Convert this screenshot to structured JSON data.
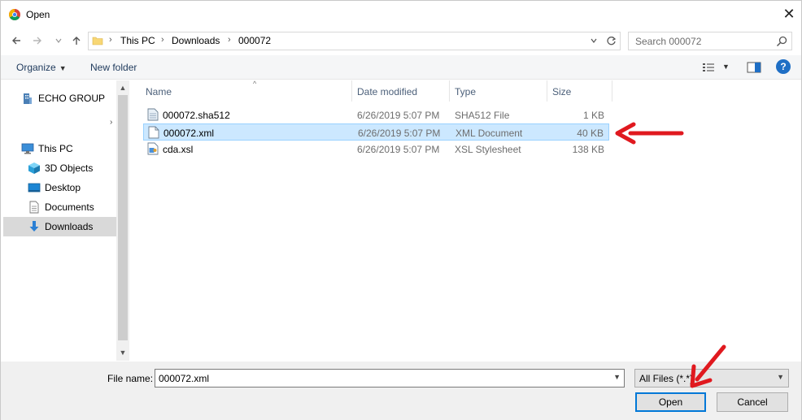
{
  "window": {
    "title": "Open",
    "close_glyph": "✕"
  },
  "address": {
    "crumbs": [
      "This PC",
      "Downloads",
      "000072"
    ],
    "separator": "›"
  },
  "search": {
    "placeholder": "Search 000072"
  },
  "toolbar": {
    "organize_label": "Organize",
    "new_folder_label": "New folder",
    "help_label": "?"
  },
  "nav": {
    "items": [
      {
        "label": "ECHO GROUP",
        "icon": "building-icon"
      },
      {
        "label": "This PC",
        "icon": "computer-icon"
      },
      {
        "label": "3D Objects",
        "icon": "3d-objects-icon"
      },
      {
        "label": "Desktop",
        "icon": "desktop-icon"
      },
      {
        "label": "Documents",
        "icon": "documents-icon"
      },
      {
        "label": "Downloads",
        "icon": "downloads-icon",
        "selected": true
      }
    ]
  },
  "columns": {
    "name": "Name",
    "date": "Date modified",
    "type": "Type",
    "size": "Size"
  },
  "files": [
    {
      "name": "000072.sha512",
      "date": "6/26/2019 5:07 PM",
      "type": "SHA512 File",
      "size": "1 KB",
      "icon": "text-file-icon"
    },
    {
      "name": "000072.xml",
      "date": "6/26/2019 5:07 PM",
      "type": "XML Document",
      "size": "40 KB",
      "icon": "xml-file-icon",
      "selected": true
    },
    {
      "name": "cda.xsl",
      "date": "6/26/2019 5:07 PM",
      "type": "XSL Stylesheet",
      "size": "138 KB",
      "icon": "xsl-file-icon"
    }
  ],
  "footer": {
    "file_name_label": "File name:",
    "file_name_value": "000072.xml",
    "filter_value": "All Files (*.*)",
    "open_label": "Open",
    "cancel_label": "Cancel"
  },
  "colors": {
    "selection": "#cce8ff",
    "selection_border": "#99d1ff",
    "annotation_arrow": "#e0191f",
    "primary_border": "#0078d7"
  }
}
